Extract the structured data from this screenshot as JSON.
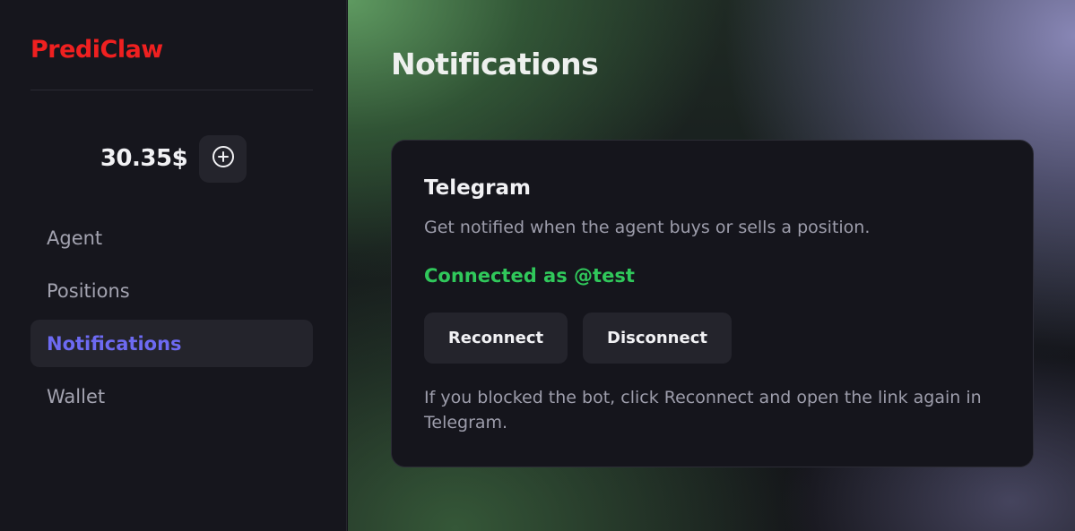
{
  "sidebar": {
    "brand": "PrediClaw",
    "balance": "30.35$",
    "add_funds_icon": "plus-circle-icon",
    "nav": [
      {
        "label": "Agent",
        "active": false
      },
      {
        "label": "Positions",
        "active": false
      },
      {
        "label": "Notifications",
        "active": true
      },
      {
        "label": "Wallet",
        "active": false
      }
    ]
  },
  "main": {
    "title": "Notifications",
    "card": {
      "title": "Telegram",
      "description": "Get notified when the agent buys or sells a position.",
      "status": "Connected as @test",
      "reconnect_label": "Reconnect",
      "disconnect_label": "Disconnect",
      "help": "If you blocked the bot, click Reconnect and open the link again in Telegram."
    }
  },
  "colors": {
    "brand": "#ef2020",
    "active_nav": "#6d6af2",
    "status_connected": "#30c85b"
  }
}
